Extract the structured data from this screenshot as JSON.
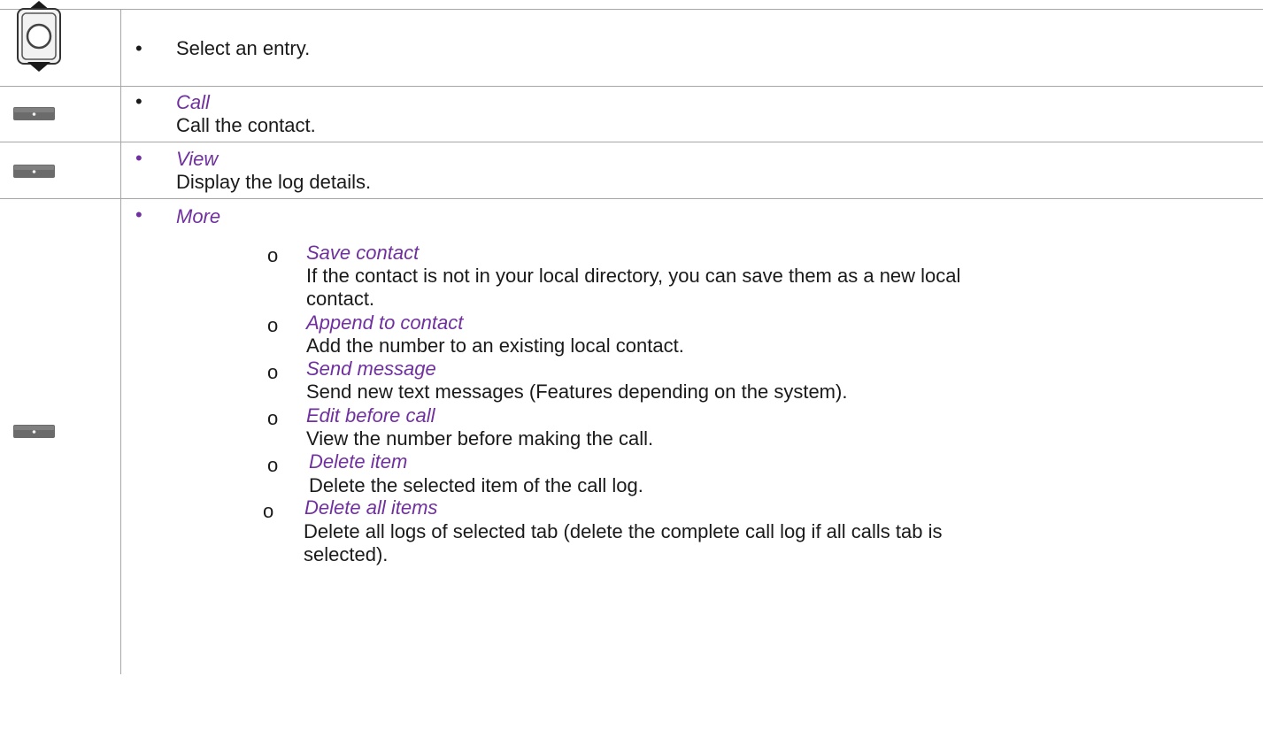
{
  "rows": [
    {
      "text": "Select an entry.",
      "icon": "navigation-key-icon"
    },
    {
      "label": "Call",
      "description": "Call the contact.",
      "icon": "softkey-icon"
    },
    {
      "label": "View",
      "description": "Display the log details.",
      "icon": "softkey-icon"
    },
    {
      "label": "More",
      "icon": "softkey-icon",
      "subitems": [
        {
          "marker": "o",
          "title": "Save contact",
          "description_lines": [
            "If the contact is not in your local directory, you can save them as a new local",
            "contact."
          ]
        },
        {
          "marker": "o",
          "title": "Append to contact",
          "description_lines": [
            "Add the number to an existing local contact."
          ]
        },
        {
          "marker": "o",
          "title": "Send message",
          "description_lines": [
            "Send new text messages (Features depending on the system)."
          ]
        },
        {
          "marker": "o",
          "title": "Edit before call",
          "description_lines": [
            "View the number before making the call."
          ]
        },
        {
          "marker": "o",
          "title": "Delete item",
          "description_lines": [
            "Delete the selected item of the call log."
          ]
        },
        {
          "marker": "o",
          "title": "Delete all items",
          "description_lines": [
            "Delete all logs of selected tab (delete the complete call log if all calls tab is",
            "selected)."
          ]
        }
      ]
    }
  ],
  "bullet": "•",
  "colors": {
    "accent": "#7030a0",
    "border": "#a6a6a6",
    "text": "#1a1a1a"
  }
}
